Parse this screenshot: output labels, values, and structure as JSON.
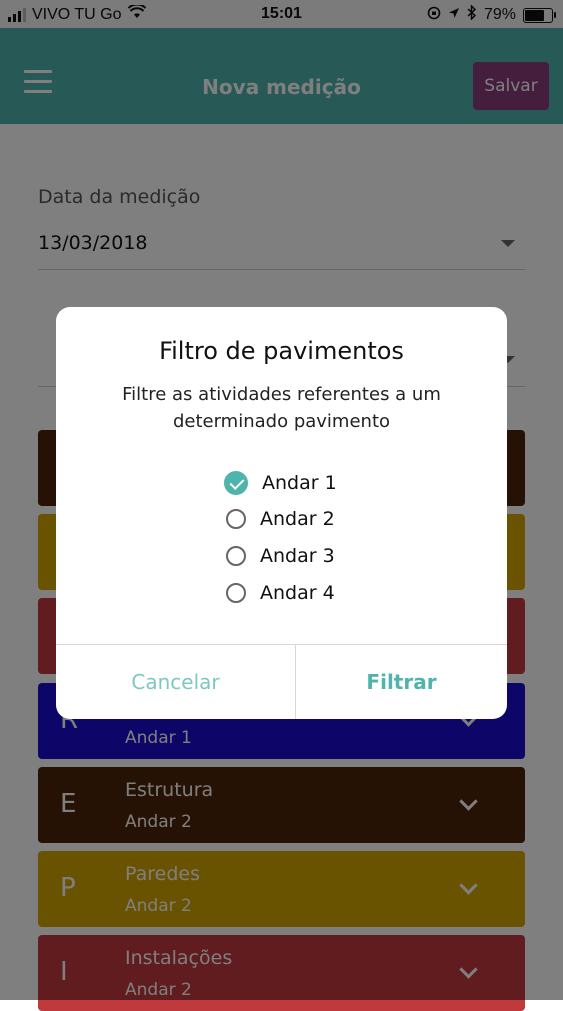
{
  "status_bar": {
    "carrier": "VIVO TU Go",
    "time": "15:01",
    "battery_percent": "79%",
    "battery_level": 0.79
  },
  "app_bar": {
    "title": "Nova medição",
    "save_label": "Salvar",
    "menu_icon": "hamburger-menu-icon",
    "color": "#4fb5ac",
    "save_color": "#8a3c7a"
  },
  "form": {
    "date_label": "Data da medição",
    "date_value": "13/03/2018"
  },
  "cards": [
    {
      "letter": "",
      "title": "",
      "subtitle": "",
      "color": "#4a2508"
    },
    {
      "letter": "",
      "title": "",
      "subtitle": "",
      "color": "#d4a600"
    },
    {
      "letter": "",
      "title": "",
      "subtitle": "",
      "color": "#c0393c"
    },
    {
      "letter": "R",
      "title": "",
      "subtitle": "Andar 1",
      "color": "#1a0ad1"
    },
    {
      "letter": "E",
      "title": "Estrutura",
      "subtitle": "Andar 2",
      "color": "#4a2508"
    },
    {
      "letter": "P",
      "title": "Paredes",
      "subtitle": "Andar 2",
      "color": "#d4a600"
    },
    {
      "letter": "I",
      "title": "Instalações",
      "subtitle": "Andar 2",
      "color": "#c0393c"
    }
  ],
  "dialog": {
    "title": "Filtro de pavimentos",
    "message": "Filtre as atividades referentes a um determinado pavimento",
    "options": [
      {
        "label": "Andar 1",
        "checked": true
      },
      {
        "label": "Andar 2",
        "checked": false
      },
      {
        "label": "Andar 3",
        "checked": false
      },
      {
        "label": "Andar 4",
        "checked": false
      }
    ],
    "cancel_label": "Cancelar",
    "filter_label": "Filtrar",
    "accent_color": "#4fb5ac"
  }
}
